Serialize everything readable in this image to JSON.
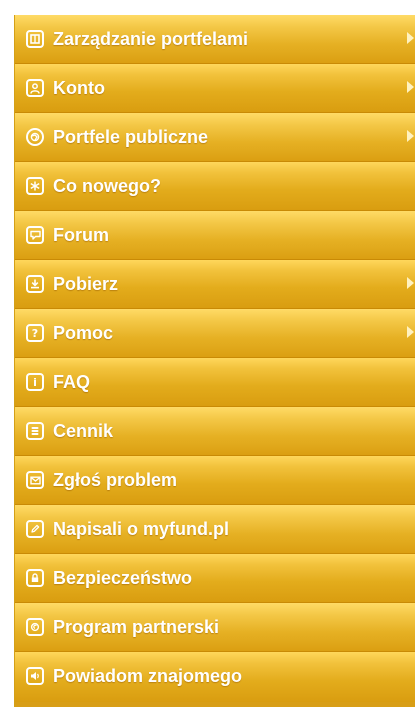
{
  "menu": {
    "items": [
      {
        "label": "Zarządzanie portfelami",
        "icon": "portfolio-window-icon",
        "submenu": true
      },
      {
        "label": "Konto",
        "icon": "user-account-icon",
        "submenu": true
      },
      {
        "label": "Portfele publiczne",
        "icon": "globe-icon",
        "submenu": true
      },
      {
        "label": "Co nowego?",
        "icon": "asterisk-star-icon",
        "submenu": false
      },
      {
        "label": "Forum",
        "icon": "speech-bubble-icon",
        "submenu": false
      },
      {
        "label": "Pobierz",
        "icon": "download-icon",
        "submenu": true
      },
      {
        "label": "Pomoc",
        "icon": "help-question-icon",
        "submenu": true
      },
      {
        "label": "FAQ",
        "icon": "info-icon",
        "submenu": false
      },
      {
        "label": "Cennik",
        "icon": "coins-stack-icon",
        "submenu": false
      },
      {
        "label": "Zgłoś problem",
        "icon": "envelope-icon",
        "submenu": false
      },
      {
        "label": "Napisali o myfund.pl",
        "icon": "pencil-icon",
        "submenu": false
      },
      {
        "label": "Bezpieczeństwo",
        "icon": "lock-icon",
        "submenu": false
      },
      {
        "label": "Program partnerski",
        "icon": "partner-program-icon",
        "submenu": false
      },
      {
        "label": "Powiadom znajomego",
        "icon": "speaker-notify-icon",
        "submenu": false
      }
    ]
  },
  "colors": {
    "menu_gradient_top": "#ffd75b",
    "menu_gradient_bottom": "#d99d10",
    "separator": "#c98a05",
    "text": "#ffffff"
  }
}
